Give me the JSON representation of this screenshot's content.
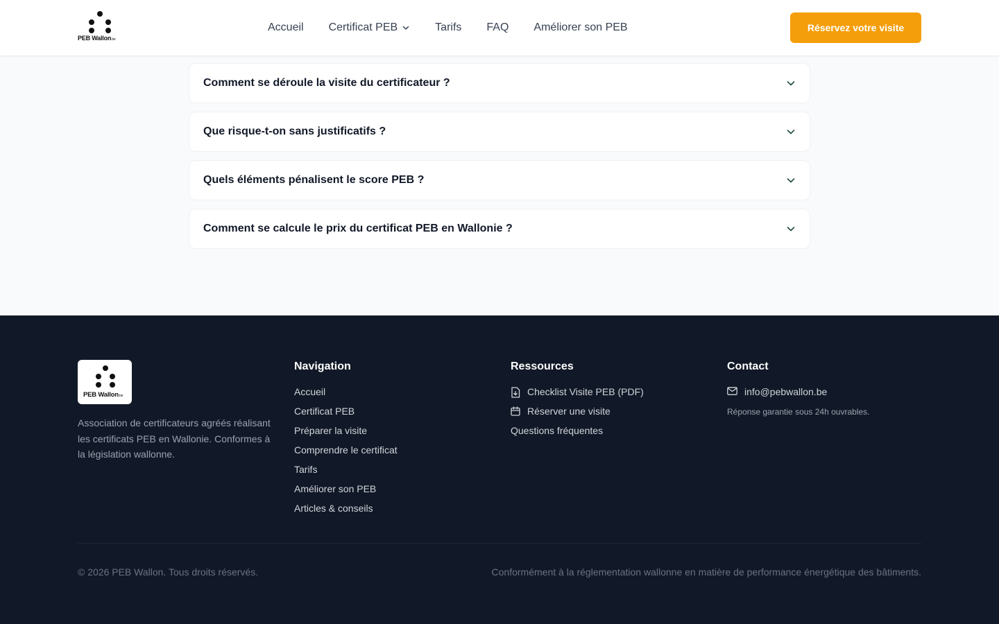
{
  "header": {
    "logo_text": "PEB Wallon",
    "logo_suffix": ".be",
    "nav": [
      {
        "label": "Accueil"
      },
      {
        "label": "Certificat PEB",
        "has_dropdown": true
      },
      {
        "label": "Tarifs"
      },
      {
        "label": "FAQ"
      },
      {
        "label": "Améliorer son PEB"
      }
    ],
    "cta_label": "Réservez votre visite",
    "accent_color": "#f59e0b"
  },
  "faq": {
    "items": [
      {
        "question": "Comment se déroule la visite du certificateur ?"
      },
      {
        "question": "Que risque-t-on sans justificatifs ?"
      },
      {
        "question": "Quels éléments pénalisent le score PEB ?"
      },
      {
        "question": "Comment se calcule le prix du certificat PEB en Wallonie ?"
      }
    ]
  },
  "footer": {
    "logo_text": "PEB Wallon",
    "logo_suffix": ".be",
    "about": "Association de certificateurs agréés réalisant les certificats PEB en Wallonie. Conformes à la législation wallonne.",
    "navigation": {
      "title": "Navigation",
      "links": [
        "Accueil",
        "Certificat PEB",
        "Préparer la visite",
        "Comprendre le certificat",
        "Tarifs",
        "Améliorer son PEB",
        "Articles & conseils"
      ]
    },
    "resources": {
      "title": "Ressources",
      "links": [
        {
          "label": "Checklist Visite PEB (PDF)",
          "icon": "file-download-icon"
        },
        {
          "label": "Réserver une visite",
          "icon": "calendar-icon"
        },
        {
          "label": "Questions fréquentes",
          "icon": ""
        }
      ]
    },
    "contact": {
      "title": "Contact",
      "email": "info@pebwallon.be",
      "note": "Réponse garantie sous 24h ouvrables."
    },
    "copyright": "© 2026 PEB Wallon. Tous droits réservés.",
    "legal": "Conformément à la réglementation wallonne en matière de performance énergétique des bâtiments.",
    "background_color": "#111827"
  }
}
